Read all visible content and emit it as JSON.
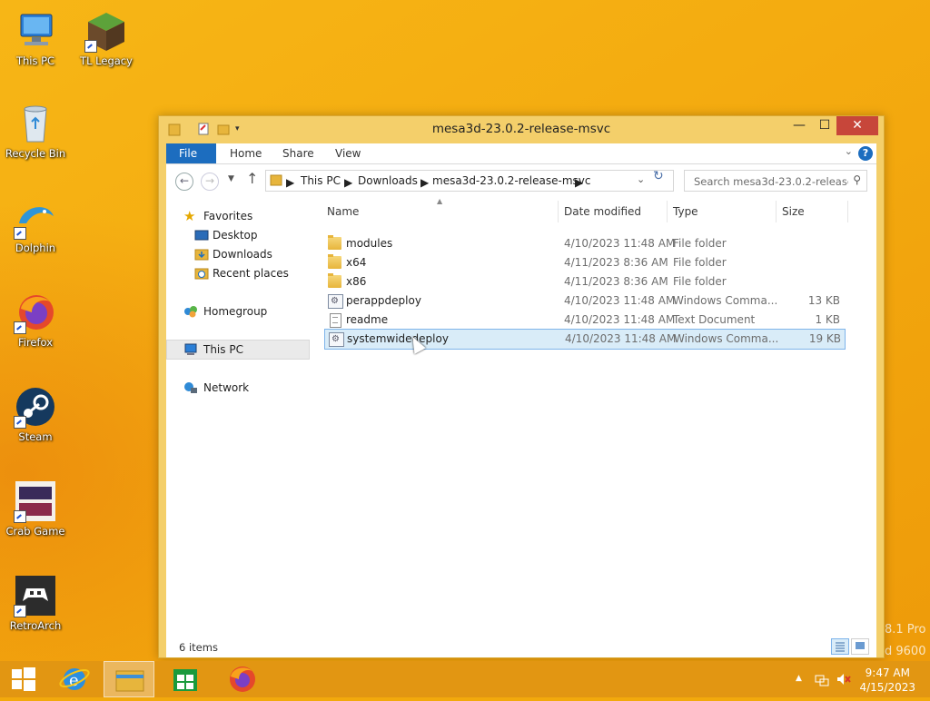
{
  "desktop": {
    "icons": [
      {
        "label": "This PC",
        "icon": "computer-icon"
      },
      {
        "label": "TL Legacy",
        "icon": "minecraft-block-icon"
      },
      {
        "label": "Recycle Bin",
        "icon": "recycle-bin-icon"
      },
      {
        "label": "Dolphin",
        "icon": "dolphin-icon"
      },
      {
        "label": "Firefox",
        "icon": "firefox-icon"
      },
      {
        "label": "Steam",
        "icon": "steam-icon"
      },
      {
        "label": "Crab Game",
        "icon": "crab-game-icon"
      },
      {
        "label": "RetroArch",
        "icon": "retroarch-icon"
      }
    ],
    "watermark_line1": "8.1 Pro",
    "watermark_line2": "d 9600"
  },
  "window": {
    "title": "mesa3d-23.0.2-release-msvc",
    "close_glyph": "✕",
    "max_glyph": "☐",
    "min_glyph": "—"
  },
  "ribbon": {
    "tabs": [
      "File",
      "Home",
      "Share",
      "View"
    ],
    "help": "?"
  },
  "address": {
    "crumbs": [
      "This PC",
      "Downloads",
      "mesa3d-23.0.2-release-msvc"
    ],
    "search_placeholder": "Search mesa3d-23.0.2-release..."
  },
  "nav": {
    "favorites": "Favorites",
    "desktop": "Desktop",
    "downloads": "Downloads",
    "recent": "Recent places",
    "homegroup": "Homegroup",
    "thispc": "This PC",
    "network": "Network"
  },
  "columns": {
    "name": "Name",
    "date": "Date modified",
    "type": "Type",
    "size": "Size"
  },
  "files": [
    {
      "name": "modules",
      "date": "4/10/2023 11:48 AM",
      "type": "File folder",
      "size": "",
      "icon": "folder-icon"
    },
    {
      "name": "x64",
      "date": "4/11/2023 8:36 AM",
      "type": "File folder",
      "size": "",
      "icon": "folder-icon"
    },
    {
      "name": "x86",
      "date": "4/11/2023 8:36 AM",
      "type": "File folder",
      "size": "",
      "icon": "folder-icon"
    },
    {
      "name": "perappdeploy",
      "date": "4/10/2023 11:48 AM",
      "type": "Windows Comma...",
      "size": "13 KB",
      "icon": "batch-file-icon"
    },
    {
      "name": "readme",
      "date": "4/10/2023 11:48 AM",
      "type": "Text Document",
      "size": "1 KB",
      "icon": "text-file-icon"
    },
    {
      "name": "systemwidedeploy",
      "date": "4/10/2023 11:48 AM",
      "type": "Windows Comma...",
      "size": "19 KB",
      "icon": "batch-file-icon"
    }
  ],
  "status": {
    "items": "6 items"
  },
  "taskbar": {
    "time": "9:47 AM",
    "date": "4/15/2023"
  },
  "colors": {
    "accent": "#1c6dbf",
    "frame": "#f4cf6a",
    "selection": "#d9ecf8"
  }
}
